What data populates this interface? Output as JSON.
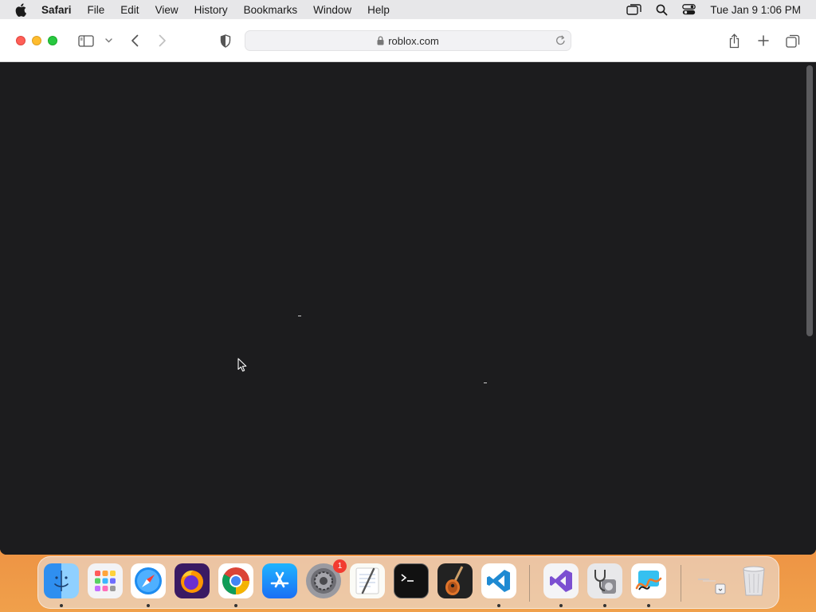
{
  "menubar": {
    "app_name": "Safari",
    "items": [
      "File",
      "Edit",
      "View",
      "History",
      "Bookmarks",
      "Window",
      "Help"
    ],
    "clock": "Tue Jan 9  1:06 PM"
  },
  "browser": {
    "url": "roblox.com"
  },
  "dock": {
    "badge_count": "1",
    "apps": [
      "finder",
      "launchpad",
      "safari",
      "firefox",
      "chrome",
      "app-store",
      "system-settings",
      "textedit",
      "terminal",
      "garageband",
      "vscode",
      "visual-studio",
      "disk-utility-stethoscope",
      "freeform",
      "downloads-stack",
      "trash"
    ]
  },
  "colors": {
    "content_bg": "#1c1c1e",
    "close": "#ff5f57",
    "minimize": "#febc2e",
    "maximize": "#28c840",
    "badge": "#f23b30"
  }
}
